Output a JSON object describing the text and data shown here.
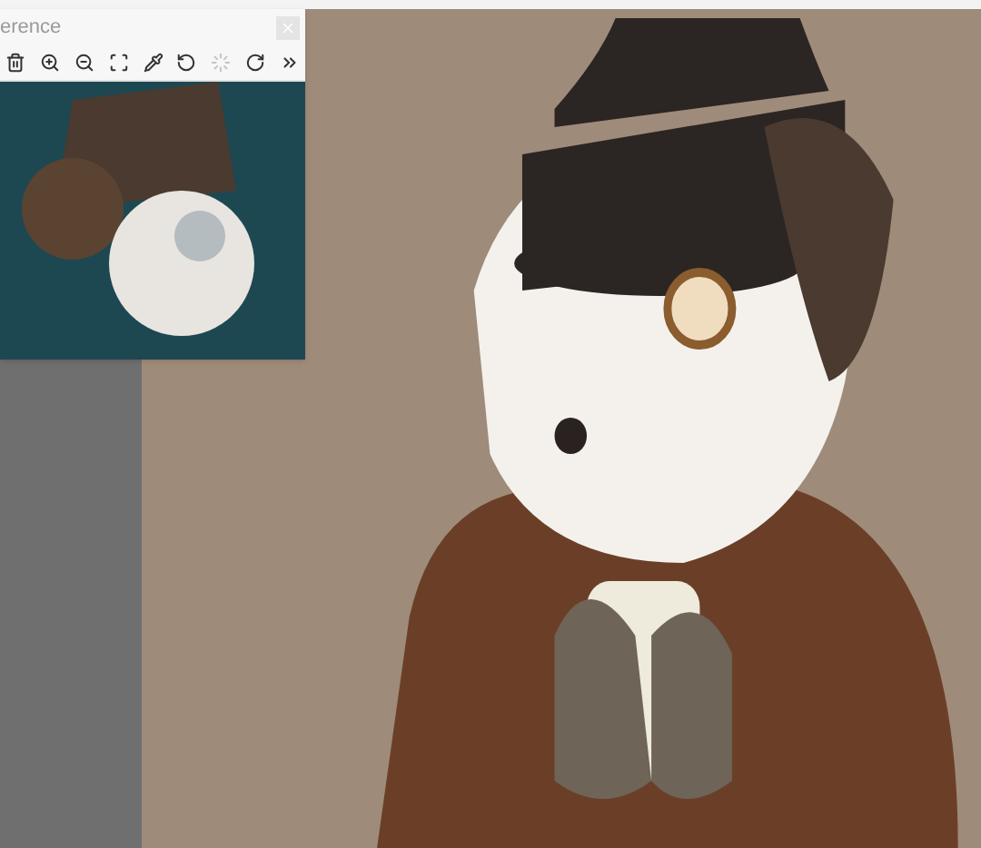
{
  "reference_panel": {
    "title": "erence",
    "tools": [
      {
        "kind": "delete",
        "disabled": false
      },
      {
        "kind": "zoom-in",
        "disabled": false
      },
      {
        "kind": "zoom-out",
        "disabled": false
      },
      {
        "kind": "fit",
        "disabled": false
      },
      {
        "kind": "eyedropper",
        "disabled": false
      },
      {
        "kind": "rotate-left",
        "disabled": false
      },
      {
        "kind": "reset",
        "disabled": true
      },
      {
        "kind": "rotate-right",
        "disabled": false
      },
      {
        "kind": "more",
        "disabled": false
      }
    ]
  }
}
